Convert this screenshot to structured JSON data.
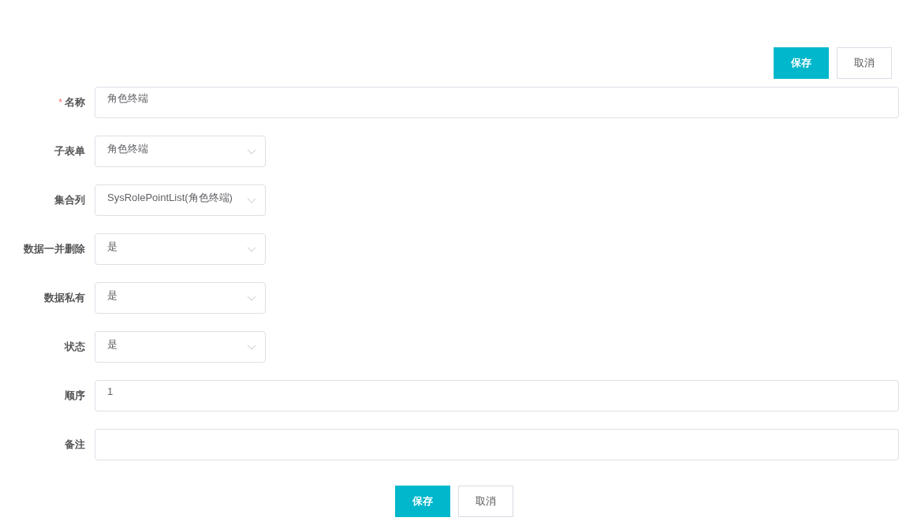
{
  "top_actions": [
    {
      "kind": "primary",
      "label": "保存"
    },
    {
      "kind": "default",
      "label": "取消"
    }
  ],
  "fields": [
    {
      "label": "名称",
      "kind": "input",
      "required_mark": "*",
      "value": "角色终端"
    },
    {
      "label": "子表单",
      "kind": "select",
      "value": "角色终端"
    },
    {
      "label": "集合列",
      "kind": "select",
      "value": "SysRolePointList(角色终端)"
    },
    {
      "label": "数据一并删除",
      "kind": "select",
      "value": "是"
    },
    {
      "label": "数据私有",
      "kind": "select",
      "value": "是"
    },
    {
      "label": "状态",
      "kind": "select",
      "value": "是"
    },
    {
      "label": "顺序",
      "kind": "input",
      "value": "1"
    },
    {
      "label": "备注",
      "kind": "input"
    }
  ],
  "bottom_actions": [
    {
      "kind": "primary",
      "label": "保存"
    },
    {
      "kind": "default",
      "label": "取消"
    }
  ]
}
